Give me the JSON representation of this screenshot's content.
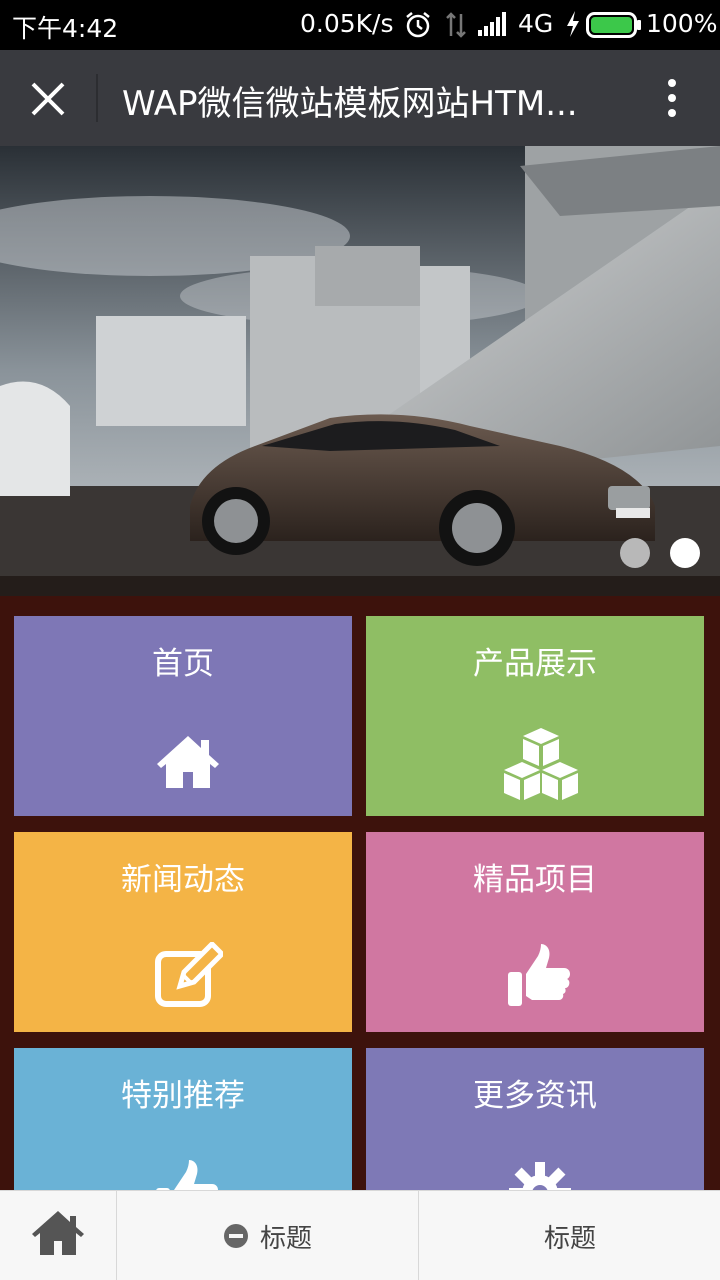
{
  "status_bar": {
    "time": "下午4:42",
    "speed": "0.05K/s",
    "network": "4G",
    "battery": "100%"
  },
  "title_bar": {
    "title": "WAP微信微站模板网站HTM..."
  },
  "banner": {
    "slide_count": 2,
    "active_slide": 2
  },
  "tiles": [
    {
      "label": "首页",
      "icon": "home-icon",
      "color": "#7e77b6"
    },
    {
      "label": "产品展示",
      "icon": "cubes-icon",
      "color": "#8fbe64"
    },
    {
      "label": "新闻动态",
      "icon": "edit-icon",
      "color": "#f4b446"
    },
    {
      "label": "精品项目",
      "icon": "thumbs-up-icon",
      "color": "#d077a1"
    },
    {
      "label": "特别推荐",
      "icon": "thumbs-up-icon",
      "color": "#6ab2d6"
    },
    {
      "label": "更多资讯",
      "icon": "gear-icon",
      "color": "#7e79b6"
    }
  ],
  "bottom_nav": {
    "home_icon": "home-icon",
    "item2_label": "标题",
    "item3_label": "标题"
  },
  "colors": {
    "background": "#3d120c",
    "title_bar": "#393a3f"
  }
}
